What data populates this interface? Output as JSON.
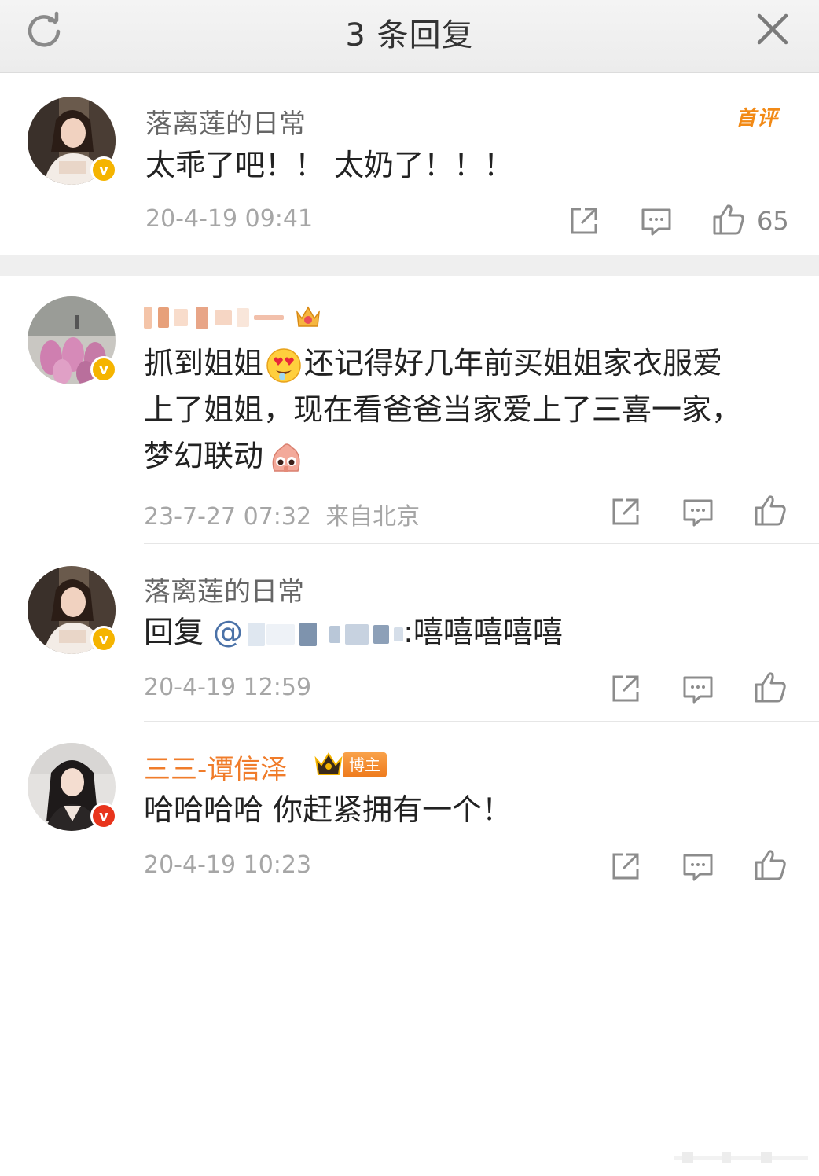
{
  "header": {
    "title": "3 条回复",
    "refresh_icon": "refresh-icon",
    "close_icon": "close-icon"
  },
  "root": {
    "username": "落离莲的日常",
    "badge": "首评",
    "text": "太乖了吧！！ 太奶了！！！",
    "time": "20-4-19 09:41",
    "likes": "65"
  },
  "replies": [
    {
      "username": "",
      "text_line1_a": "抓到姐姐",
      "text_line1_b": "还记得好几年前买姐姐家衣服爱",
      "text_line2": "上了姐姐，现在看爸爸当家爱上了三喜一家，",
      "text_line3": "梦幻联动",
      "time": "23-7-27 07:32",
      "location": "来自北京"
    },
    {
      "username": "落离莲的日常",
      "reply_prefix": "回复",
      "mention_at": "@",
      "text_suffix": ":嘻嘻嘻嘻嘻",
      "time": "20-4-19 12:59"
    },
    {
      "username": "三三-谭信泽",
      "badge": "博主",
      "text": "哈哈哈哈 你赶紧拥有一个！",
      "time": "20-4-19 10:23"
    }
  ],
  "colors": {
    "accent_orange": "#f07c2a",
    "mention_blue": "#4b72a8",
    "verified_gold": "#f5b400",
    "verified_red": "#e8341c"
  }
}
